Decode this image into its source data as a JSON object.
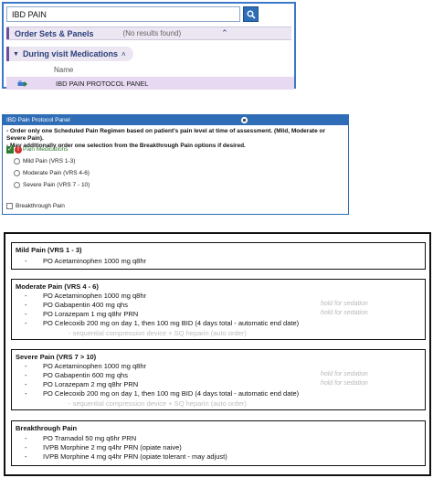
{
  "search": {
    "query": "IBD PAIN",
    "orders_title": "Order Sets & Panels",
    "orders_note": "(No results found)",
    "visit_label": "During visit Medications",
    "name_header": "Name",
    "result_label": "IBD PAIN PROTOCOL PANEL"
  },
  "protocol": {
    "header": "IBD Pain Protocol Panel",
    "instruction1": "- Order only one Scheduled Pain Regimen based on patient's pain level at time of assessment. (Mild, Moderate or Severe Pain).",
    "instruction2": "- May additionally order one selection from the Breakthrough Pain options if desired.",
    "pain_meds": "Pain Medications",
    "options": [
      "Mild Pain (VRS 1-3)",
      "Moderate Pain (VRS 4-6)",
      "Severe Pain (VRS 7 - 10)"
    ],
    "breakthrough": "Breakthrough Pain"
  },
  "regimens": {
    "mild": {
      "title": "Mild Pain (VRS 1 - 3)",
      "items": [
        {
          "dash": "-",
          "text": "PO Acetaminophen 1000 mg q8hr"
        }
      ]
    },
    "moderate": {
      "title": "Moderate Pain (VRS 4 - 6)",
      "items": [
        {
          "dash": "-",
          "text": "PO Acetaminophen 1000 mg q8hr",
          "note": ""
        },
        {
          "dash": "-",
          "text": "PO Gabapentin 400 mg qhs",
          "note": "hold for sedation"
        },
        {
          "dash": "-",
          "text": "PO Lorazepam 1 mg q8hr PRN",
          "note": "hold for sedation"
        },
        {
          "dash": "-",
          "text": "PO Celecoxib 200 mg on day 1, then 100 mg BID (4 days total - automatic end date)",
          "note": ""
        }
      ],
      "sub": "-    sequential compression device + SQ heparin (auto order)"
    },
    "severe": {
      "title": "Severe Pain (VRS 7 > 10)",
      "items": [
        {
          "dash": "-",
          "text": "PO Acetaminophen 1000 mg q8hr",
          "note": ""
        },
        {
          "dash": "-",
          "text": "PO Gabapentin 600 mg qhs",
          "note": "hold for sedation"
        },
        {
          "dash": "-",
          "text": "PO Lorazepam 2 mg q8hr PRN",
          "note": "hold for sedation"
        },
        {
          "dash": "-",
          "text": "PO Celecoxib 200 mg on day 1, then 100 mg BID (4 days total - automatic end date)",
          "note": ""
        }
      ],
      "sub": "-    sequential compression device + SQ heparin (auto order)"
    },
    "breakthrough": {
      "title": "Breakthrough Pain",
      "items": [
        {
          "dash": "-",
          "text": "PO Tramadol 50 mg q6hr PRN"
        },
        {
          "dash": "-",
          "text": "IVPB Morphine 2 mg q4hr PRN (opiate naive)"
        },
        {
          "dash": "-",
          "text": "IVPB Morphine 4 mg q4hr PRN (opiate tolerant - may adjust)"
        }
      ]
    }
  },
  "colors": {
    "accent_blue": "#2f6db6",
    "purple_band": "#ebe6f1",
    "purple_bar": "#6c4e9b",
    "selected_row": "#e6d9f1",
    "check_green": "#2e7d32",
    "alert_red": "#d32f2f"
  },
  "icons": [
    "search-icon",
    "chevron-up-icon",
    "order-set-icon",
    "expand-icon",
    "check-icon",
    "alert-icon"
  ]
}
